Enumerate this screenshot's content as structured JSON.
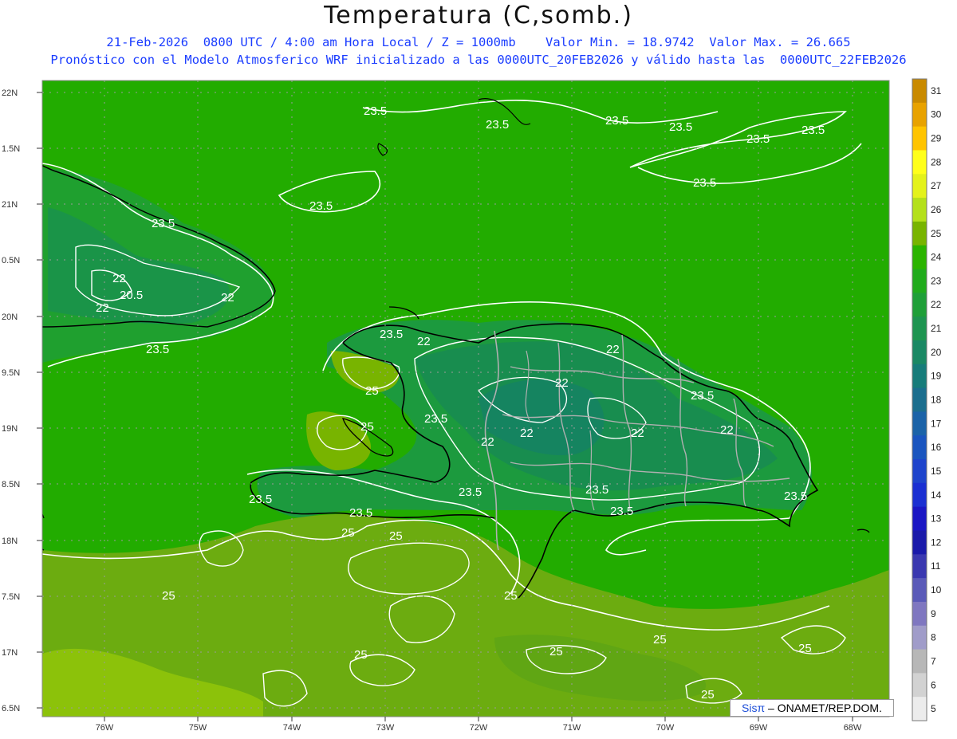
{
  "title": "Temperatura (C,somb.)",
  "subtitle_line1": "21-Feb-2026  0800 UTC / 4:00 am Hora Local / Z = 1000mb    Valor Min. = 18.9742  Valor Max. = 26.665",
  "subtitle_line2": "Pronóstico con el Modelo Atmosferico WRF inicializado a las 0000UTC_20FEB2026 y válido hasta las  0000UTC_22FEB2026",
  "credit": {
    "brand": "Sisπ",
    "text": " – ONAMET/REP.DOM."
  },
  "axes": {
    "lat_labels": [
      "22N",
      "1.5N",
      "21N",
      "0.5N",
      "20N",
      "9.5N",
      "19N",
      "8.5N",
      "18N",
      "7.5N",
      "17N",
      "6.5N"
    ],
    "lon_labels": [
      "76W",
      "75W",
      "74W",
      "73W",
      "72W",
      "71W",
      "70W",
      "69W",
      "68W"
    ]
  },
  "colorbar": {
    "labels": [
      "31",
      "30",
      "29",
      "28",
      "27",
      "26",
      "25",
      "24",
      "23",
      "22",
      "21",
      "20",
      "19",
      "18",
      "17",
      "16",
      "15",
      "14",
      "13",
      "12",
      "11",
      "10",
      "9",
      "8",
      "7",
      "6",
      "5"
    ],
    "colors": [
      "#c98a00",
      "#e8a200",
      "#ffc400",
      "#ffff1a",
      "#e4f21a",
      "#b4e01a",
      "#78b400",
      "#2bb400",
      "#21ab1c",
      "#1f9f38",
      "#1e9450",
      "#1a8864",
      "#177c7a",
      "#1b6e8e",
      "#1b63a8",
      "#1a55bf",
      "#1e44cc",
      "#1a2fd2",
      "#1a16c4",
      "#1a1aaa",
      "#3a38b0",
      "#5a5ab8",
      "#7f77c0",
      "#a09cc9",
      "#b7b7b7",
      "#d2d2d2",
      "#ececec"
    ]
  },
  "contour_labels": [
    {
      "text": "23.5"
    },
    {
      "text": "23.5"
    },
    {
      "text": "23.5"
    },
    {
      "text": "23.5"
    },
    {
      "text": "23.5"
    },
    {
      "text": "23.5"
    },
    {
      "text": "23.5"
    },
    {
      "text": "23.5"
    },
    {
      "text": "23.5"
    },
    {
      "text": "22"
    },
    {
      "text": "20.5"
    },
    {
      "text": "22"
    },
    {
      "text": "22"
    },
    {
      "text": "23.5"
    },
    {
      "text": "23.5"
    },
    {
      "text": "22"
    },
    {
      "text": "22"
    },
    {
      "text": "22"
    },
    {
      "text": "23.5"
    },
    {
      "text": "25"
    },
    {
      "text": "25"
    },
    {
      "text": "23.5"
    },
    {
      "text": "22"
    },
    {
      "text": "22"
    },
    {
      "text": "22"
    },
    {
      "text": "22"
    },
    {
      "text": "23.5"
    },
    {
      "text": "23.5"
    },
    {
      "text": "23.5"
    },
    {
      "text": "23.5"
    },
    {
      "text": "23.5"
    },
    {
      "text": "25"
    },
    {
      "text": "25"
    },
    {
      "text": "25"
    },
    {
      "text": "25"
    },
    {
      "text": "25"
    },
    {
      "text": "25"
    },
    {
      "text": "25"
    },
    {
      "text": "25"
    },
    {
      "text": "25"
    },
    {
      "text": "23.5"
    }
  ]
}
